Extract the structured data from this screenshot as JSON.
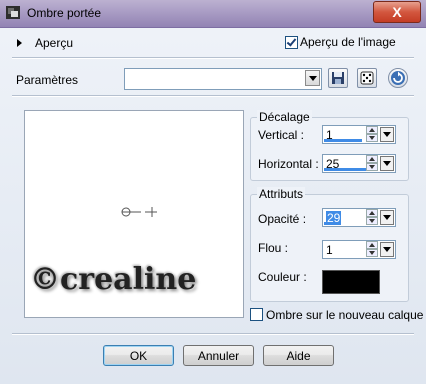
{
  "window": {
    "title": "Ombre portée",
    "close_glyph": "X"
  },
  "preview_section": {
    "label": "Aperçu",
    "image_preview_label": "Aperçu de l'image",
    "image_preview_checked": true
  },
  "params": {
    "label": "Paramètres",
    "value": ""
  },
  "offset": {
    "title": "Décalage",
    "vertical_label": "Vertical :",
    "vertical_value": "1",
    "horizontal_label": "Horizontal :",
    "horizontal_value": "25"
  },
  "attributes": {
    "title": "Attributs",
    "opacity_label": "Opacité :",
    "opacity_value": "29",
    "blur_label": "Flou :",
    "blur_value": "1",
    "color_label": "Couleur :",
    "color_value": "#000000"
  },
  "new_layer": {
    "label": "Ombre sur le nouveau calque",
    "checked": false
  },
  "buttons": {
    "ok": "OK",
    "cancel": "Annuler",
    "help": "Aide"
  },
  "watermark": "©crealine",
  "icons": [
    "app-icon",
    "close-icon",
    "expand-triangle-icon",
    "save-preset-icon",
    "randomize-icon",
    "reset-icon"
  ]
}
